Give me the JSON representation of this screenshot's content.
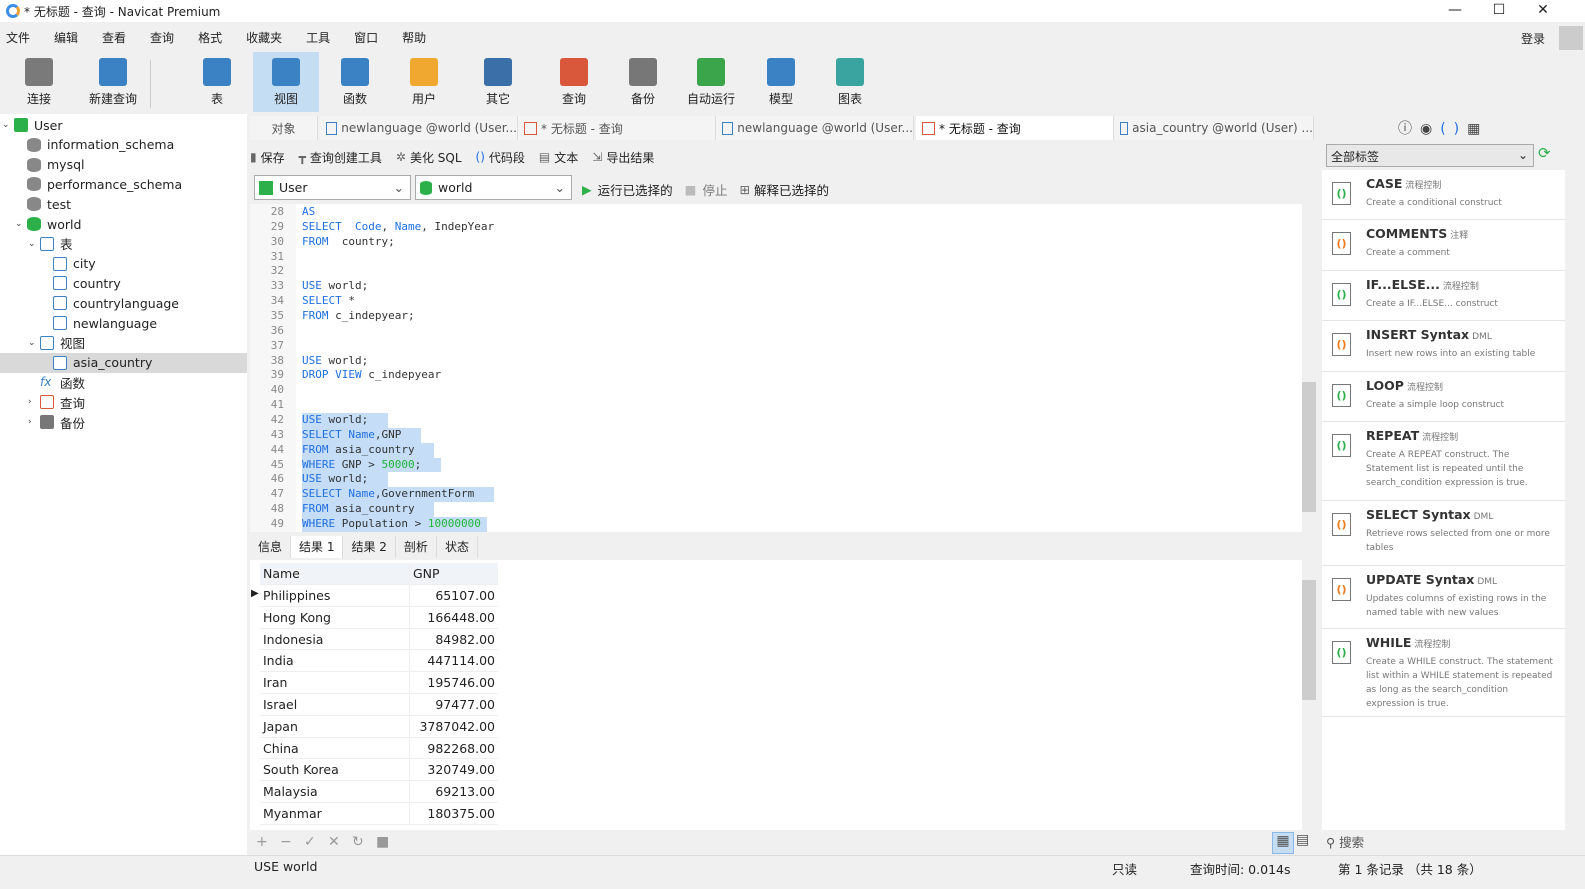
{
  "window": {
    "title": "* 无标题 - 查询 - Navicat Premium",
    "min": "—",
    "max": "☐",
    "close": "✕"
  },
  "menu": [
    "文件",
    "编辑",
    "查看",
    "查询",
    "格式",
    "收藏夹",
    "工具",
    "窗口",
    "帮助"
  ],
  "login": "登录",
  "toolbar": [
    {
      "label": "连接",
      "icon": "plug-icon",
      "color": "#7a7a7a"
    },
    {
      "label": "新建查询",
      "icon": "new-query-icon",
      "color": "#3b82c4"
    },
    {
      "label": "表",
      "icon": "table-icon",
      "color": "#3b82c4"
    },
    {
      "label": "视图",
      "icon": "view-icon",
      "color": "#3b82c4",
      "active": true
    },
    {
      "label": "函数",
      "icon": "function-icon",
      "color": "#3b82c4"
    },
    {
      "label": "用户",
      "icon": "user-icon",
      "color": "#f0a830"
    },
    {
      "label": "其它",
      "icon": "tools-icon",
      "color": "#3b6fa8"
    },
    {
      "label": "查询",
      "icon": "query-icon",
      "color": "#d9573a"
    },
    {
      "label": "备份",
      "icon": "backup-icon",
      "color": "#777"
    },
    {
      "label": "自动运行",
      "icon": "autorun-icon",
      "color": "#3aa54a"
    },
    {
      "label": "模型",
      "icon": "model-icon",
      "color": "#3b82c4"
    },
    {
      "label": "图表",
      "icon": "chart-icon",
      "color": "#3aa5a0"
    }
  ],
  "tree": [
    {
      "label": "User",
      "level": 0,
      "arrow": "v",
      "icon": "connection-icon"
    },
    {
      "label": "information_schema",
      "level": 1,
      "icon": "database-icon"
    },
    {
      "label": "mysql",
      "level": 1,
      "icon": "database-icon"
    },
    {
      "label": "performance_schema",
      "level": 1,
      "icon": "database-icon"
    },
    {
      "label": "test",
      "level": 1,
      "icon": "database-icon"
    },
    {
      "label": "world",
      "level": 1,
      "arrow": "v",
      "icon": "database-icon",
      "color": "#2bb04a"
    },
    {
      "label": "表",
      "level": 2,
      "arrow": "v",
      "icon": "table-folder-icon"
    },
    {
      "label": "city",
      "level": 3,
      "icon": "table-icon"
    },
    {
      "label": "country",
      "level": 3,
      "icon": "table-icon"
    },
    {
      "label": "countrylanguage",
      "level": 3,
      "icon": "table-icon"
    },
    {
      "label": "newlanguage",
      "level": 3,
      "icon": "table-icon"
    },
    {
      "label": "视图",
      "level": 2,
      "arrow": "v",
      "icon": "view-folder-icon"
    },
    {
      "label": "asia_country",
      "level": 3,
      "icon": "view-icon",
      "selected": true
    },
    {
      "label": "函数",
      "level": 2,
      "icon": "function-icon"
    },
    {
      "label": "查询",
      "level": 2,
      "arrow": ">",
      "icon": "query-icon"
    },
    {
      "label": "备份",
      "level": 2,
      "arrow": ">",
      "icon": "backup-icon"
    }
  ],
  "tabs": [
    {
      "label": "对象"
    },
    {
      "label": "newlanguage @world (User..."
    },
    {
      "label": "* 无标题 - 查询"
    },
    {
      "label": "newlanguage @world (User..."
    },
    {
      "label": "* 无标题 - 查询",
      "active": true
    },
    {
      "label": "asia_country @world (User) ..."
    }
  ],
  "editor_toolbar": [
    "保存",
    "查询创建工具",
    "美化 SQL",
    "代码段",
    "文本",
    "导出结果"
  ],
  "connection_select": "User",
  "database_select": "world",
  "run_selected": "运行已选择的",
  "stop": "停止",
  "explain_selected": "解释已选择的",
  "code_lines": [
    {
      "n": "28",
      "html": "<span class='kw'>AS</span>"
    },
    {
      "n": "29",
      "html": "<span class='kw'>SELECT</span>  <span class='kw'>Code</span>, <span class='kw'>Name</span>, IndepYear"
    },
    {
      "n": "30",
      "html": "<span class='kw'>FROM</span>  country;"
    },
    {
      "n": "31",
      "html": ""
    },
    {
      "n": "32",
      "html": ""
    },
    {
      "n": "33",
      "html": "<span class='kw'>USE</span> world;"
    },
    {
      "n": "34",
      "html": "<span class='kw'>SELECT</span> *"
    },
    {
      "n": "35",
      "html": "<span class='kw'>FROM</span> c_indepyear;"
    },
    {
      "n": "36",
      "html": ""
    },
    {
      "n": "37",
      "html": ""
    },
    {
      "n": "38",
      "html": "<span class='kw'>USE</span> world;"
    },
    {
      "n": "39",
      "html": "<span class='kw'>DROP</span> <span class='kw'>VIEW</span> c_indepyear"
    },
    {
      "n": "40",
      "html": ""
    },
    {
      "n": "41",
      "html": ""
    },
    {
      "n": "42",
      "html": "<span class='kw'>USE</span> world;   ",
      "hl": true
    },
    {
      "n": "43",
      "html": "<span class='kw'>SELECT</span> <span class='kw'>Name</span>,GNP   ",
      "hl": true
    },
    {
      "n": "44",
      "html": "<span class='kw'>FROM</span> asia_country   ",
      "hl": true
    },
    {
      "n": "45",
      "html": "<span class='kw'>WHERE</span> GNP &gt; <span class='num'>50000</span>;   ",
      "hl": true
    },
    {
      "n": "46",
      "html": "<span class='kw'>USE</span> world;   ",
      "hl": true
    },
    {
      "n": "47",
      "html": "<span class='kw'>SELECT</span> <span class='kw'>Name</span>,GovernmentForm   ",
      "hl": true
    },
    {
      "n": "48",
      "html": "<span class='kw'>FROM</span> asia_country   ",
      "hl": true
    },
    {
      "n": "49",
      "html": "<span class='kw'>WHERE</span> Population &gt; <span class='num'>10000000</span> ",
      "hl": true
    }
  ],
  "result_tabs": [
    "信息",
    "结果 1",
    "结果 2",
    "剖析",
    "状态"
  ],
  "result": {
    "columns": [
      "Name",
      "GNP"
    ],
    "rows": [
      [
        "Philippines",
        "65107.00"
      ],
      [
        "Hong Kong",
        "166448.00"
      ],
      [
        "Indonesia",
        "84982.00"
      ],
      [
        "India",
        "447114.00"
      ],
      [
        "Iran",
        "195746.00"
      ],
      [
        "Israel",
        "97477.00"
      ],
      [
        "Japan",
        "3787042.00"
      ],
      [
        "China",
        "982268.00"
      ],
      [
        "South Korea",
        "320749.00"
      ],
      [
        "Malaysia",
        "69213.00"
      ],
      [
        "Myanmar",
        "180375.00"
      ]
    ]
  },
  "grid_buttons": [
    "+",
    "−",
    "✓",
    "✕",
    "↻",
    "■"
  ],
  "status": {
    "sql": "USE world",
    "readonly": "只读",
    "time": "查询时间: 0.014s",
    "record": "第 1 条记录 （共 18 条）"
  },
  "snippets": {
    "filter": "全部标签",
    "search_placeholder": "搜索",
    "items": [
      {
        "title": "CASE",
        "tag": "流程控制",
        "desc": "Create a conditional construct",
        "kind": "flow"
      },
      {
        "title": "COMMENTS",
        "tag": "注释",
        "desc": "Create a comment",
        "kind": "dml"
      },
      {
        "title": "IF...ELSE...",
        "tag": "流程控制",
        "desc": "Create a IF...ELSE... construct",
        "kind": "flow"
      },
      {
        "title": "INSERT Syntax",
        "tag": "DML",
        "desc": "Insert new rows into an existing table",
        "kind": "dml"
      },
      {
        "title": "LOOP",
        "tag": "流程控制",
        "desc": "Create a simple loop construct",
        "kind": "flow"
      },
      {
        "title": "REPEAT",
        "tag": "流程控制",
        "desc": "Create A REPEAT construct. The Statement list is repeated until the search_condition expression is true.",
        "kind": "flow"
      },
      {
        "title": "SELECT Syntax",
        "tag": "DML",
        "desc": "Retrieve rows selected from one or more tables",
        "kind": "dml"
      },
      {
        "title": "UPDATE Syntax",
        "tag": "DML",
        "desc": "Updates columns of existing rows in the named table with new values",
        "kind": "dml"
      },
      {
        "title": "WHILE",
        "tag": "流程控制",
        "desc": "Create a WHILE construct. The statement list within a WHILE statement is repeated as long as the search_condition expression is true.",
        "kind": "flow"
      }
    ]
  }
}
